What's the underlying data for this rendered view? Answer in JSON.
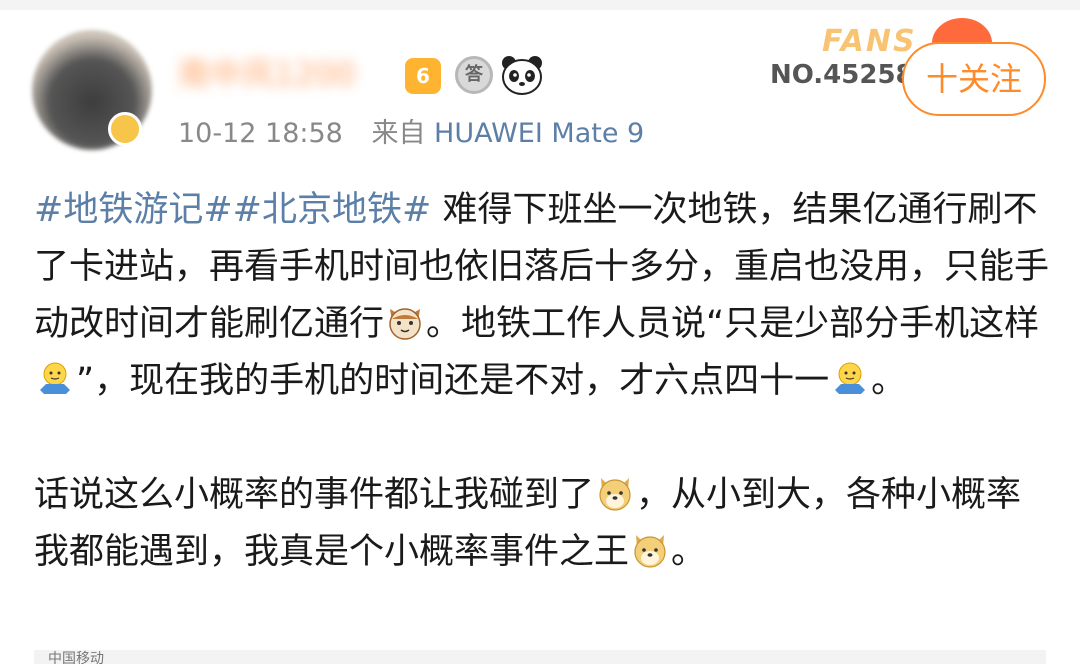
{
  "user": {
    "name": "南中风1200",
    "member_level": "6",
    "answer_badge": "答",
    "time": "10-12 18:58",
    "source_prefix": "来自",
    "device": "HUAWEI Mate 9"
  },
  "fans_badge": {
    "word": "FANS",
    "number": "NO.452580"
  },
  "follow": {
    "label": "十关注"
  },
  "post": {
    "tags": [
      "#地铁游记#",
      "#北京地铁#"
    ],
    "p1_a": "难得下班坐一次地铁，结果亿通行刷不了卡进站，再看手机时间也依旧落后十多分，重启也没用，只能手动改时间才能刷亿通行",
    "p1_b": "。地铁工作人员说“只是少部分手机这样",
    "p1_c": "”，现在我的手机的时间还是不对，才六点四十一",
    "p1_d": "。",
    "p2_a": "话说这么小概率的事件都让我碰到了",
    "p2_b": "，从小到大，各种小概率我都能遇到，我真是个小概率事件之王",
    "p2_c": "。"
  },
  "footer": {
    "carrier": "中国移动"
  },
  "icons": {
    "member": "member-level-icon",
    "answer": "answer-badge-icon",
    "panda": "panda-icon",
    "cat": "cat-emoji-icon",
    "shrug": "shrug-emoji-icon",
    "doge": "doge-emoji-icon"
  },
  "colors": {
    "link": "#5c7fa8",
    "accent": "#ff8a2a",
    "meta": "#888888",
    "text": "#1a1a1a"
  }
}
